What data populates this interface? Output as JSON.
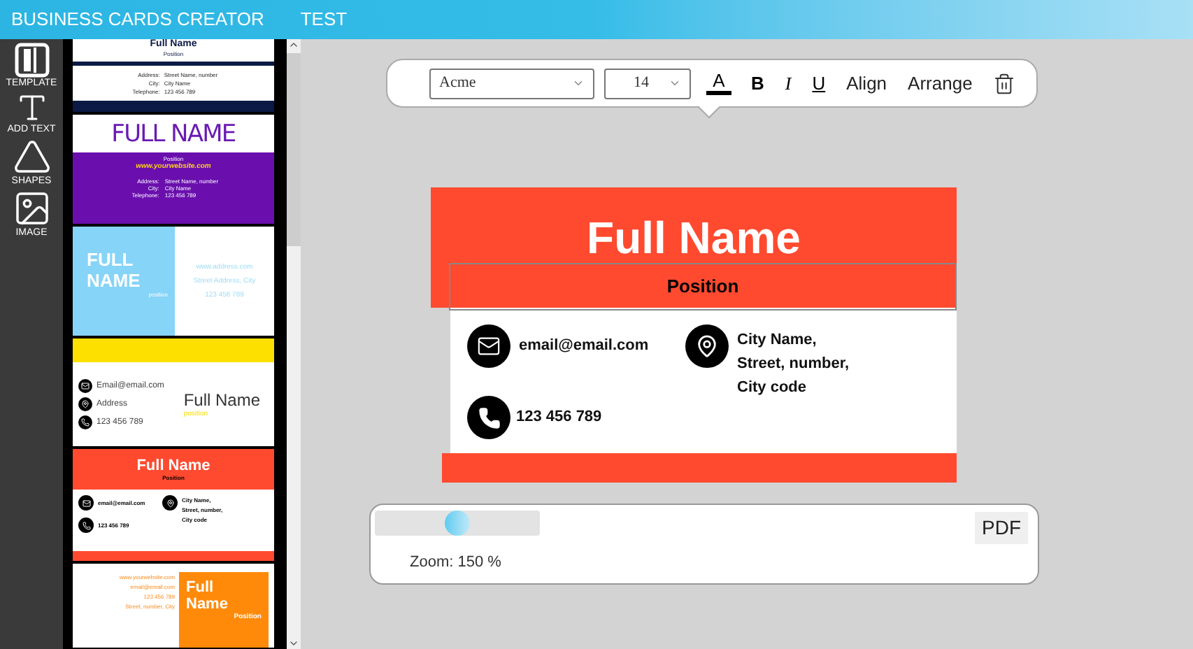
{
  "header": {
    "title": "BUSINESS CARDS CREATOR",
    "subtitle": "TEST"
  },
  "tools": [
    {
      "kind": "template",
      "label": "TEMPLATE"
    },
    {
      "kind": "text",
      "label": "ADD TEXT"
    },
    {
      "kind": "shapes",
      "label": "SHAPES"
    },
    {
      "kind": "image",
      "label": "IMAGE"
    }
  ],
  "templates": [
    {
      "kind": "navy",
      "name": "Full Name",
      "position": "Position",
      "lines": [
        [
          "Address:",
          "Street Name, number"
        ],
        [
          "City:",
          "City Name"
        ],
        [
          "Telephone:",
          "123 456 789"
        ]
      ]
    },
    {
      "kind": "purple",
      "name": "FULL NAME",
      "position": "Position",
      "website": "www.yourwebsite.com",
      "lines": [
        [
          "Address:",
          "Street Name, number"
        ],
        [
          "City:",
          "City Name"
        ],
        [
          "Telephone:",
          "123 456 789"
        ]
      ]
    },
    {
      "kind": "lightblue",
      "name_lines": [
        "FULL",
        "NAME"
      ],
      "position": "position",
      "contacts": [
        "www.address.com",
        "Street Address, City",
        "123 456 789"
      ]
    },
    {
      "kind": "yellow",
      "contacts": [
        "Email@email.com",
        "Address",
        "123 456 789"
      ],
      "name": "Full Name",
      "position": "position"
    },
    {
      "kind": "red",
      "name": "Full Name",
      "position": "Position",
      "email": "email@email.com",
      "address": [
        "City Name,",
        "Street, number,",
        "City code"
      ],
      "phone": "123 456 789"
    },
    {
      "kind": "orange",
      "contacts": [
        "www.yourwebsite.com",
        "email@email.com",
        "123 456 789",
        "Street, number, City"
      ],
      "name_lines": [
        "Full",
        "Name"
      ],
      "position": "Position"
    }
  ],
  "toolbar": {
    "font": "Acme",
    "size": "14",
    "buttons": [
      {
        "kind": "color",
        "label": "A"
      },
      {
        "kind": "bold",
        "label": "B"
      },
      {
        "kind": "italic",
        "label": "I"
      },
      {
        "kind": "underline",
        "label": "U"
      },
      {
        "kind": "plain",
        "label": "Align"
      },
      {
        "kind": "plain",
        "label": "Arrange"
      },
      {
        "kind": "delete"
      }
    ]
  },
  "card": {
    "name": "Full Name",
    "position": "Position",
    "email": "email@email.com",
    "address": [
      "City Name,",
      "Street, number,",
      "City code"
    ],
    "phone": "123 456 789"
  },
  "zoom": {
    "level": 0.5,
    "label": "Zoom: 150 %",
    "export": "PDF"
  }
}
